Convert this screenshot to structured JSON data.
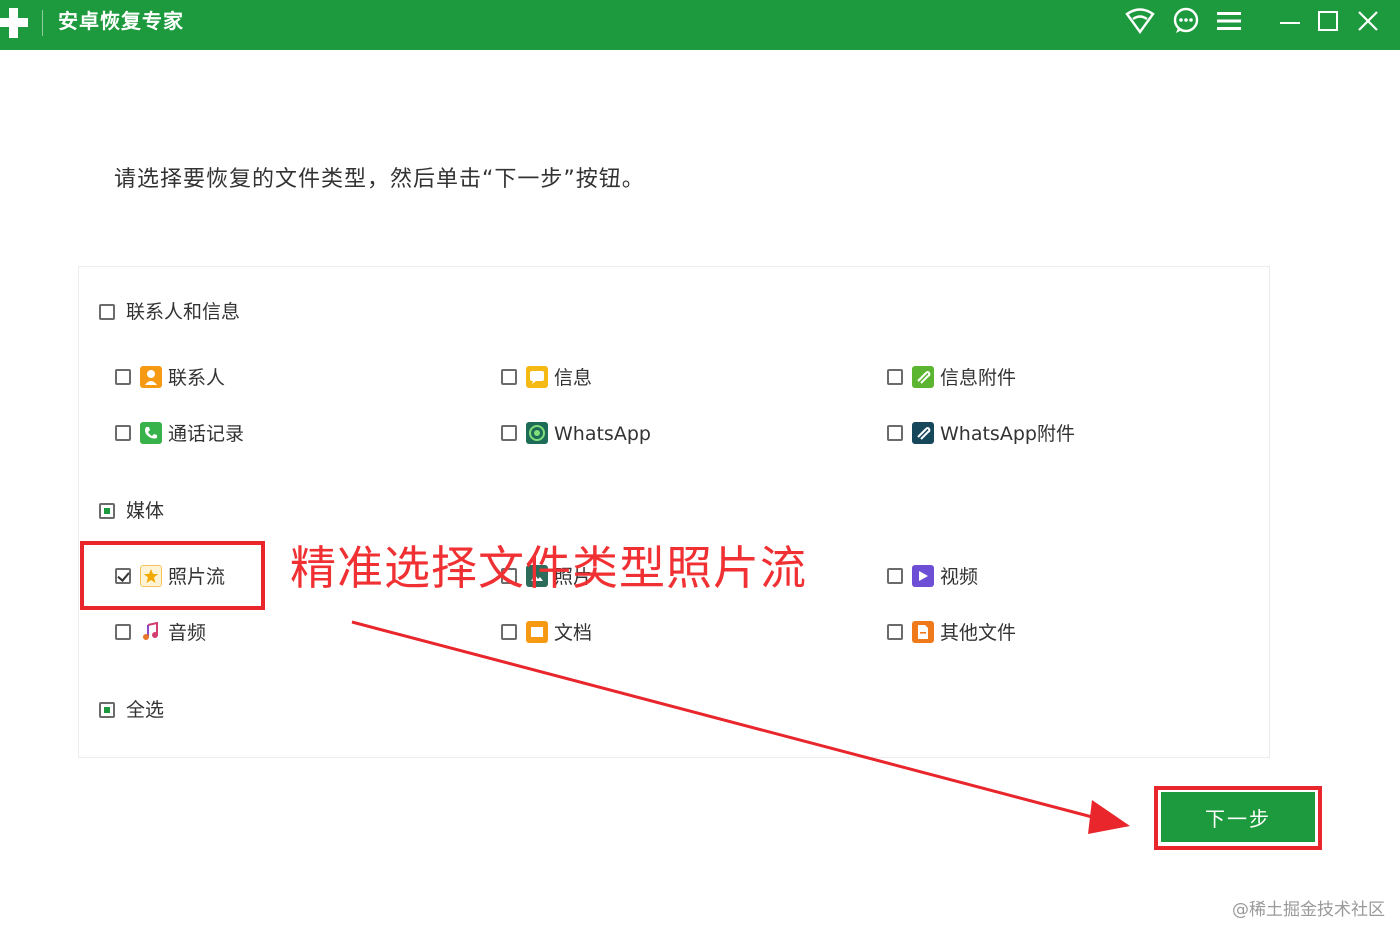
{
  "window": {
    "title": "安卓恢复专家",
    "accent_color": "#1d9a3d",
    "icons": [
      "wifi-icon",
      "chat-icon",
      "menu-icon",
      "minimize-icon",
      "maximize-icon",
      "close-icon"
    ]
  },
  "instruction": "请选择要恢复的文件类型，然后单击“下一步”按钮。",
  "groups": {
    "contacts_messages": {
      "label": "联系人和信息",
      "state": "unchecked",
      "items": [
        {
          "label": "联系人",
          "icon": "contact-icon",
          "checked": false
        },
        {
          "label": "信息",
          "icon": "message-icon",
          "checked": false
        },
        {
          "label": "信息附件",
          "icon": "attachment-icon",
          "checked": false
        },
        {
          "label": "通话记录",
          "icon": "phone-icon",
          "checked": false
        },
        {
          "label": "WhatsApp",
          "icon": "whatsapp-icon",
          "checked": false
        },
        {
          "label": "WhatsApp附件",
          "icon": "whatsapp-attachment-icon",
          "checked": false
        }
      ]
    },
    "media": {
      "label": "媒体",
      "state": "partial",
      "items": [
        {
          "label": "照片流",
          "icon": "star-icon",
          "checked": true
        },
        {
          "label": "照片",
          "icon": "photo-icon",
          "checked": false
        },
        {
          "label": "视频",
          "icon": "video-icon",
          "checked": false
        },
        {
          "label": "音频",
          "icon": "music-icon",
          "checked": false
        },
        {
          "label": "文档",
          "icon": "document-icon",
          "checked": false
        },
        {
          "label": "其他文件",
          "icon": "file-icon",
          "checked": false
        }
      ]
    }
  },
  "select_all": {
    "label": "全选",
    "state": "partial"
  },
  "annotation": {
    "text": "精准选择文件类型照片流",
    "color": "#f03033"
  },
  "next_button": {
    "label": "下一步"
  },
  "watermark": "@稀土掘金技术社区"
}
